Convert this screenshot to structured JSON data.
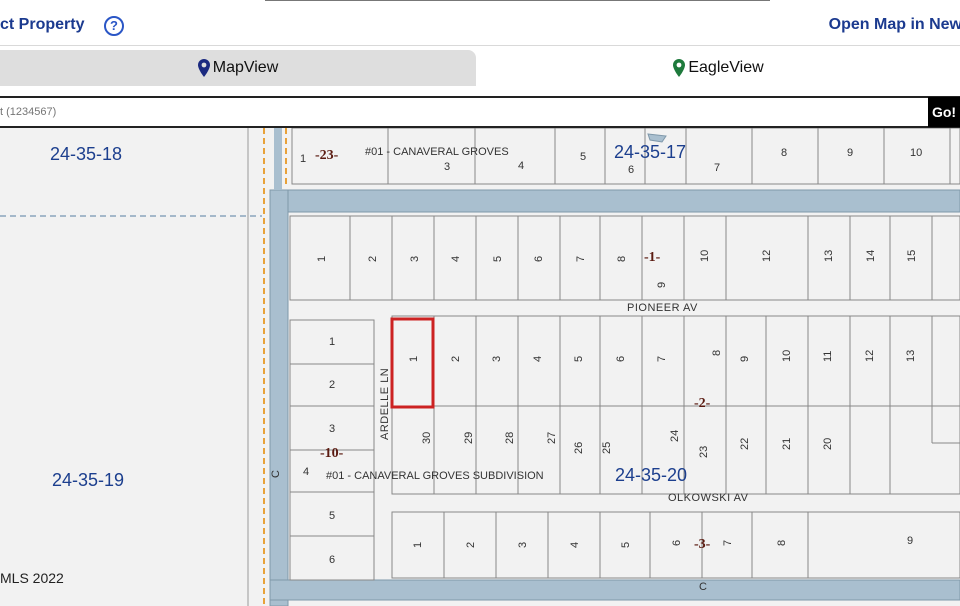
{
  "header": {
    "title": "ct Property",
    "help_icon": "question-circle-icon",
    "open_link": "Open Map in New"
  },
  "tabs": [
    {
      "label": "MapView",
      "icon": "map-pin-icon",
      "icon_color": "#1b2a80",
      "active": true
    },
    {
      "label": "EagleView",
      "icon": "map-pin-icon",
      "icon_color": "#1e7a3c",
      "active": false
    }
  ],
  "search": {
    "placeholder": "t (1234567)",
    "go_label": "Go!"
  },
  "map": {
    "copyright": "MLS 2022",
    "sections": [
      "24-35-18",
      "24-35-17",
      "24-35-19",
      "24-35-20"
    ],
    "subdivisions": [
      "#01 - CANAVERAL GROVES",
      "#01 - CANAVERAL GROVES SUBDIVISION"
    ],
    "streets": [
      "PIONEER AV",
      "OLKOWSKI AV",
      "ARDELLE LN",
      "C",
      "C"
    ],
    "blocks": [
      "-23-",
      "-1-",
      "-2-",
      "-10-",
      "-3-"
    ],
    "lots_block23": [
      "1",
      "3",
      "4",
      "5",
      "6",
      "7",
      "8",
      "9",
      "10"
    ],
    "lots_block1": [
      "1",
      "2",
      "3",
      "4",
      "5",
      "6",
      "7",
      "8",
      "9",
      "10",
      "12",
      "13",
      "14",
      "15"
    ],
    "lots_block2_top": [
      "1",
      "2",
      "3",
      "4",
      "5",
      "6",
      "7",
      "8",
      "9",
      "10",
      "11",
      "12",
      "13"
    ],
    "lots_block2_bottom": [
      "30",
      "29",
      "28",
      "27",
      "26",
      "25",
      "24",
      "23",
      "22",
      "21",
      "20"
    ],
    "lots_block10": [
      "1",
      "2",
      "3",
      "4",
      "5",
      "6"
    ],
    "lots_block3": [
      "1",
      "2",
      "3",
      "4",
      "5",
      "6",
      "7",
      "8",
      "9"
    ],
    "colors": {
      "road": "#a9bfcf",
      "boundary": "#e8a23a",
      "selected": "#cc2222",
      "section_text": "#1c3f8e"
    }
  }
}
